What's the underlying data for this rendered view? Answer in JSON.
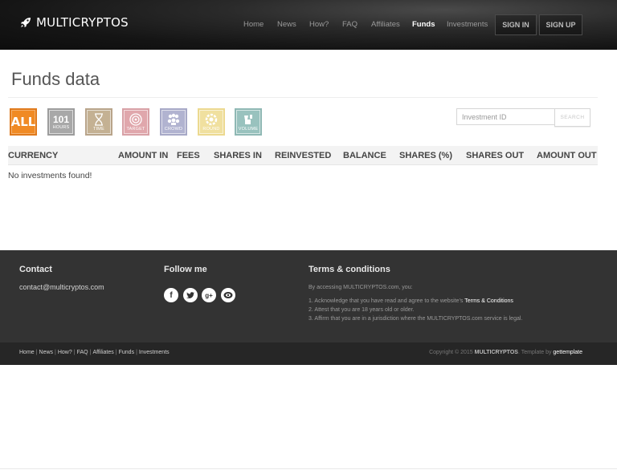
{
  "header": {
    "brand": "MULTICRYPTOS",
    "nav": [
      "Home",
      "News",
      "How?",
      "FAQ",
      "Affiliates",
      "Funds",
      "Investments"
    ],
    "active_nav": "Funds",
    "sign_in": "SIGN IN",
    "sign_up": "SIGN UP"
  },
  "main": {
    "title": "Funds data",
    "filters": {
      "all": "ALL",
      "hours_number": "101",
      "hours_label": "HOURS",
      "time_label": "TIME",
      "target_label": "TARGET",
      "crowd_label": "CROWD",
      "round_label": "ROUND",
      "volume_label": "VOLUME"
    },
    "search": {
      "placeholder": "Investment ID",
      "button": "SEARCH"
    },
    "table": {
      "columns": [
        "CURRENCY",
        "AMOUNT IN",
        "FEES",
        "SHARES IN",
        "REINVESTED",
        "BALANCE",
        "SHARES (%)",
        "SHARES OUT",
        "AMOUNT OUT"
      ],
      "empty_message": "No investments found!"
    }
  },
  "footer": {
    "contact_title": "Contact",
    "contact_email": "contact@multicryptos.com",
    "follow_title": "Follow me",
    "social_icons": [
      "facebook-icon",
      "twitter-icon",
      "google-plus-icon",
      "skype-icon"
    ],
    "terms_title": "Terms & conditions",
    "terms_intro": "By accessing MULTICRYPTOS.com, you:",
    "terms_item1_prefix": "1. Acknowledge that you have read and agree to the website's ",
    "terms_item1_link": "Terms & Conditions",
    "terms_item2": "2. Attest that you are 18 years old or older.",
    "terms_item3": "3. Affirm that you are in a jurisdiction where the MULTICRYPTOS.com service is legal.",
    "links": [
      "Home",
      "News",
      "How?",
      "FAQ",
      "Affiliates",
      "Funds",
      "Investments"
    ],
    "copyright_prefix": "Copyright © 2015 ",
    "copyright_brand": "MULTICRYPTOS",
    "copyright_mid": ". Template by ",
    "copyright_author": "gettemplate"
  }
}
